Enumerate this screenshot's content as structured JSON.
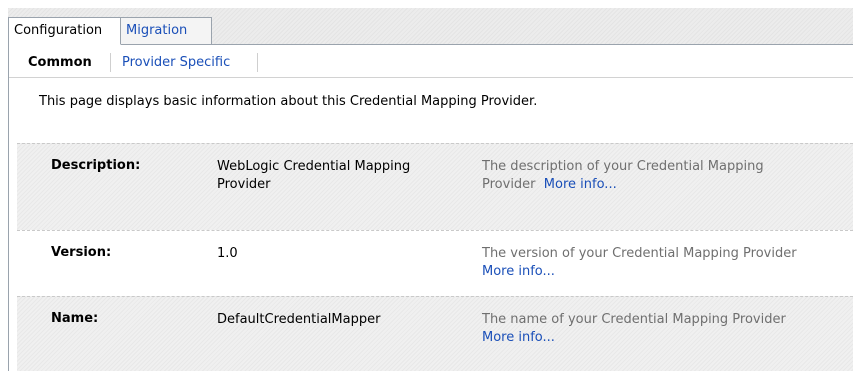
{
  "tabs": [
    {
      "label": "Configuration",
      "active": true
    },
    {
      "label": "Migration",
      "active": false
    }
  ],
  "subtabs": [
    {
      "label": "Common",
      "active": true
    },
    {
      "label": "Provider Specific",
      "active": false
    }
  ],
  "intro": "This page displays basic information about this Credential Mapping Provider.",
  "fields": [
    {
      "label": "Description:",
      "value": "WebLogic Credential Mapping Provider",
      "help": "The description of your Credential Mapping Provider",
      "more": "More info..."
    },
    {
      "label": "Version:",
      "value": "1.0",
      "help": "The version of your Credential Mapping Provider",
      "more": "More info..."
    },
    {
      "label": "Name:",
      "value": "DefaultCredentialMapper",
      "help": "The name of your Credential Mapping Provider",
      "more": "More info..."
    }
  ],
  "colors": {
    "link": "#1a4fb8",
    "help_text": "#6f6f6f",
    "border": "#9aa3ad"
  }
}
